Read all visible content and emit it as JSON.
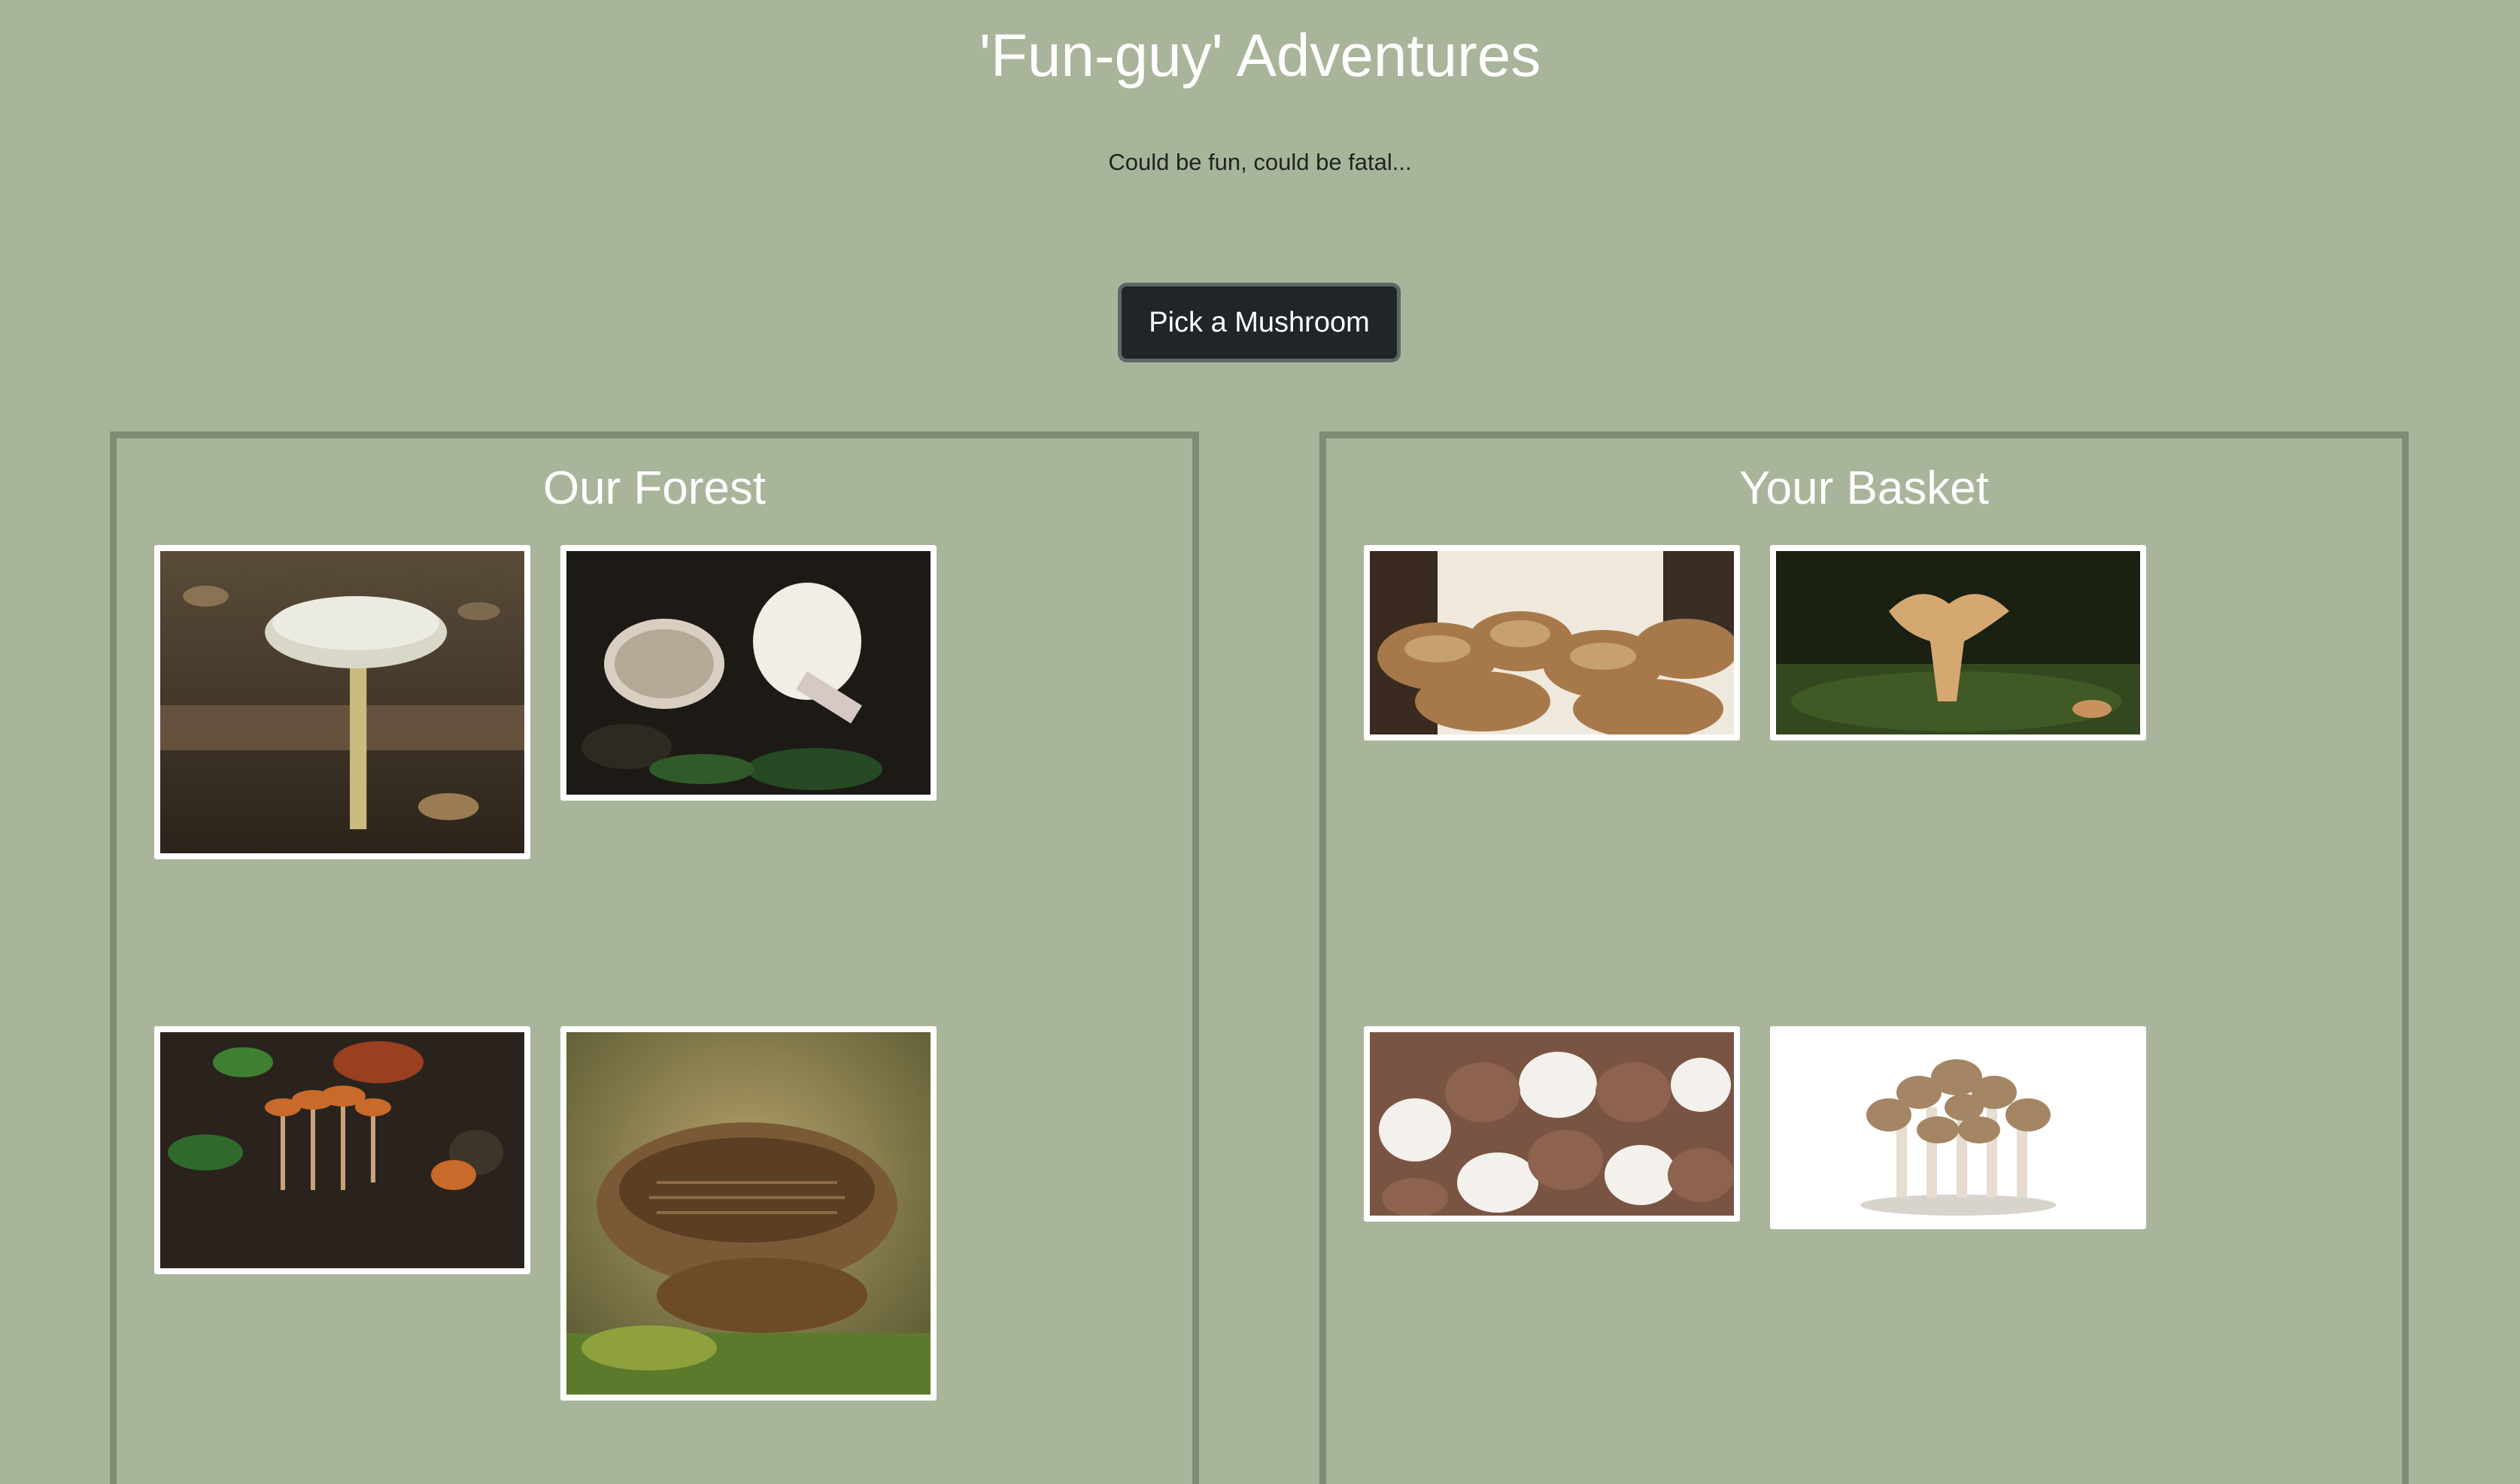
{
  "header": {
    "title": "'Fun-guy' Adventures",
    "subtitle": "Could be fun, could be fatal..."
  },
  "actions": {
    "pick_label": "Pick a Mushroom"
  },
  "forest": {
    "title": "Our Forest",
    "items": [
      {
        "icon": "tall-white-mushroom-photo"
      },
      {
        "icon": "white-gilled-mushrooms-photo"
      },
      {
        "icon": "small-orange-mushrooms-photo"
      },
      {
        "icon": "brown-gilled-mushroom-photo"
      }
    ]
  },
  "basket": {
    "title": "Your Basket",
    "items": [
      {
        "icon": "shiitake-cluster-photo"
      },
      {
        "icon": "chanterelle-photo"
      },
      {
        "icon": "button-mushrooms-photo"
      },
      {
        "icon": "beech-mushroom-cluster-photo"
      }
    ]
  },
  "colors": {
    "background": "#a8b59a",
    "panel_border": "#7f8b72",
    "button_bg": "#212529",
    "title_text": "#ffffff"
  }
}
